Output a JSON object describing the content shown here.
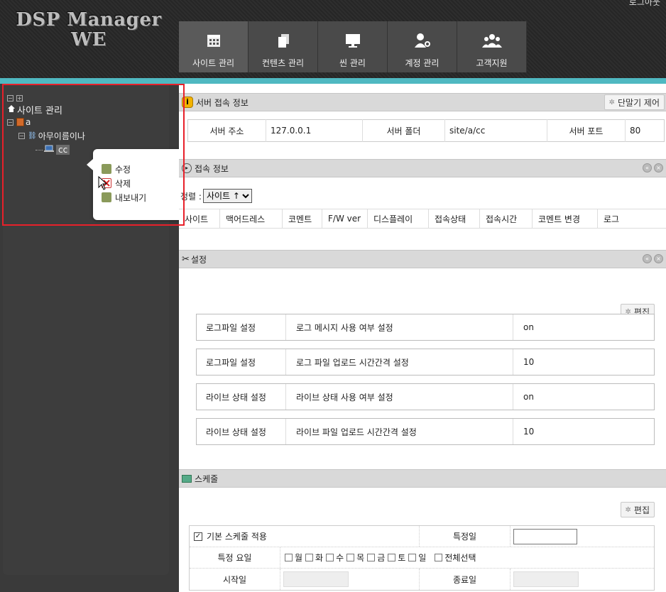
{
  "app": {
    "title_line1": "DSP Manager",
    "title_line2": "WE",
    "logout": "로그아웃"
  },
  "nav": {
    "tabs": [
      {
        "label": "사이트 관리",
        "icon": "calendar-icon"
      },
      {
        "label": "컨텐츠 관리",
        "icon": "copy-icon"
      },
      {
        "label": "씬 관리",
        "icon": "monitor-icon"
      },
      {
        "label": "계정 관리",
        "icon": "user-gear-icon"
      },
      {
        "label": "고객지원",
        "icon": "users-icon"
      }
    ]
  },
  "tree": {
    "root": "사이트 관리",
    "site": "a",
    "group": "아무이름이나",
    "device": "cc"
  },
  "context_menu": {
    "items": [
      {
        "label": "수정",
        "icon": "edit-icon"
      },
      {
        "label": "삭제",
        "icon": "delete-icon"
      },
      {
        "label": "내보내기",
        "icon": "export-icon"
      }
    ]
  },
  "server_info": {
    "title": "서버 접속 정보",
    "button": "단말기 제어",
    "address_label": "서버 주소",
    "address": "127.0.0.1",
    "folder_label": "서버 폴더",
    "folder": "site/a/cc",
    "port_label": "서버 포트",
    "port": "80"
  },
  "connection": {
    "title": "접속 정보",
    "sort_label": "정렬 :",
    "sort_value": "사이트 ↑",
    "columns": [
      "사이트",
      "맥어드레스",
      "코멘트",
      "F/W ver",
      "디스플레이",
      "접속상태",
      "접속시간",
      "코멘트 변경",
      "로그"
    ]
  },
  "settings": {
    "title": "설정",
    "edit_button": "편집",
    "rows": [
      {
        "category": "로그파일 설정",
        "desc": "로그 메시지 사용 여부 설정",
        "value": "on"
      },
      {
        "category": "로그파일 설정",
        "desc": "로그 파일 업로드 시간간격 설정",
        "value": "10"
      },
      {
        "category": "라이브 상태 설정",
        "desc": "라이브 상태 사용 여부 설정",
        "value": "on"
      },
      {
        "category": "라이브 상태 설정",
        "desc": "라이브 파일 업로드 시간간격 설정",
        "value": "10"
      }
    ]
  },
  "schedule": {
    "title": "스케줄",
    "edit_button": "편집",
    "basic_label": "기본 스케줄 적용",
    "special_day_label": "특정일",
    "special_weekday_label": "특정 요일",
    "days": [
      "월",
      "화",
      "수",
      "목",
      "금",
      "토",
      "일"
    ],
    "select_all": "전체선택",
    "start_label": "시작일",
    "end_label": "종료일"
  },
  "colors": {
    "accent": "#4fb8c1",
    "highlight": "#e8202a",
    "header_bg": "#2b2b2b",
    "panel_head": "#d9d9d9"
  }
}
